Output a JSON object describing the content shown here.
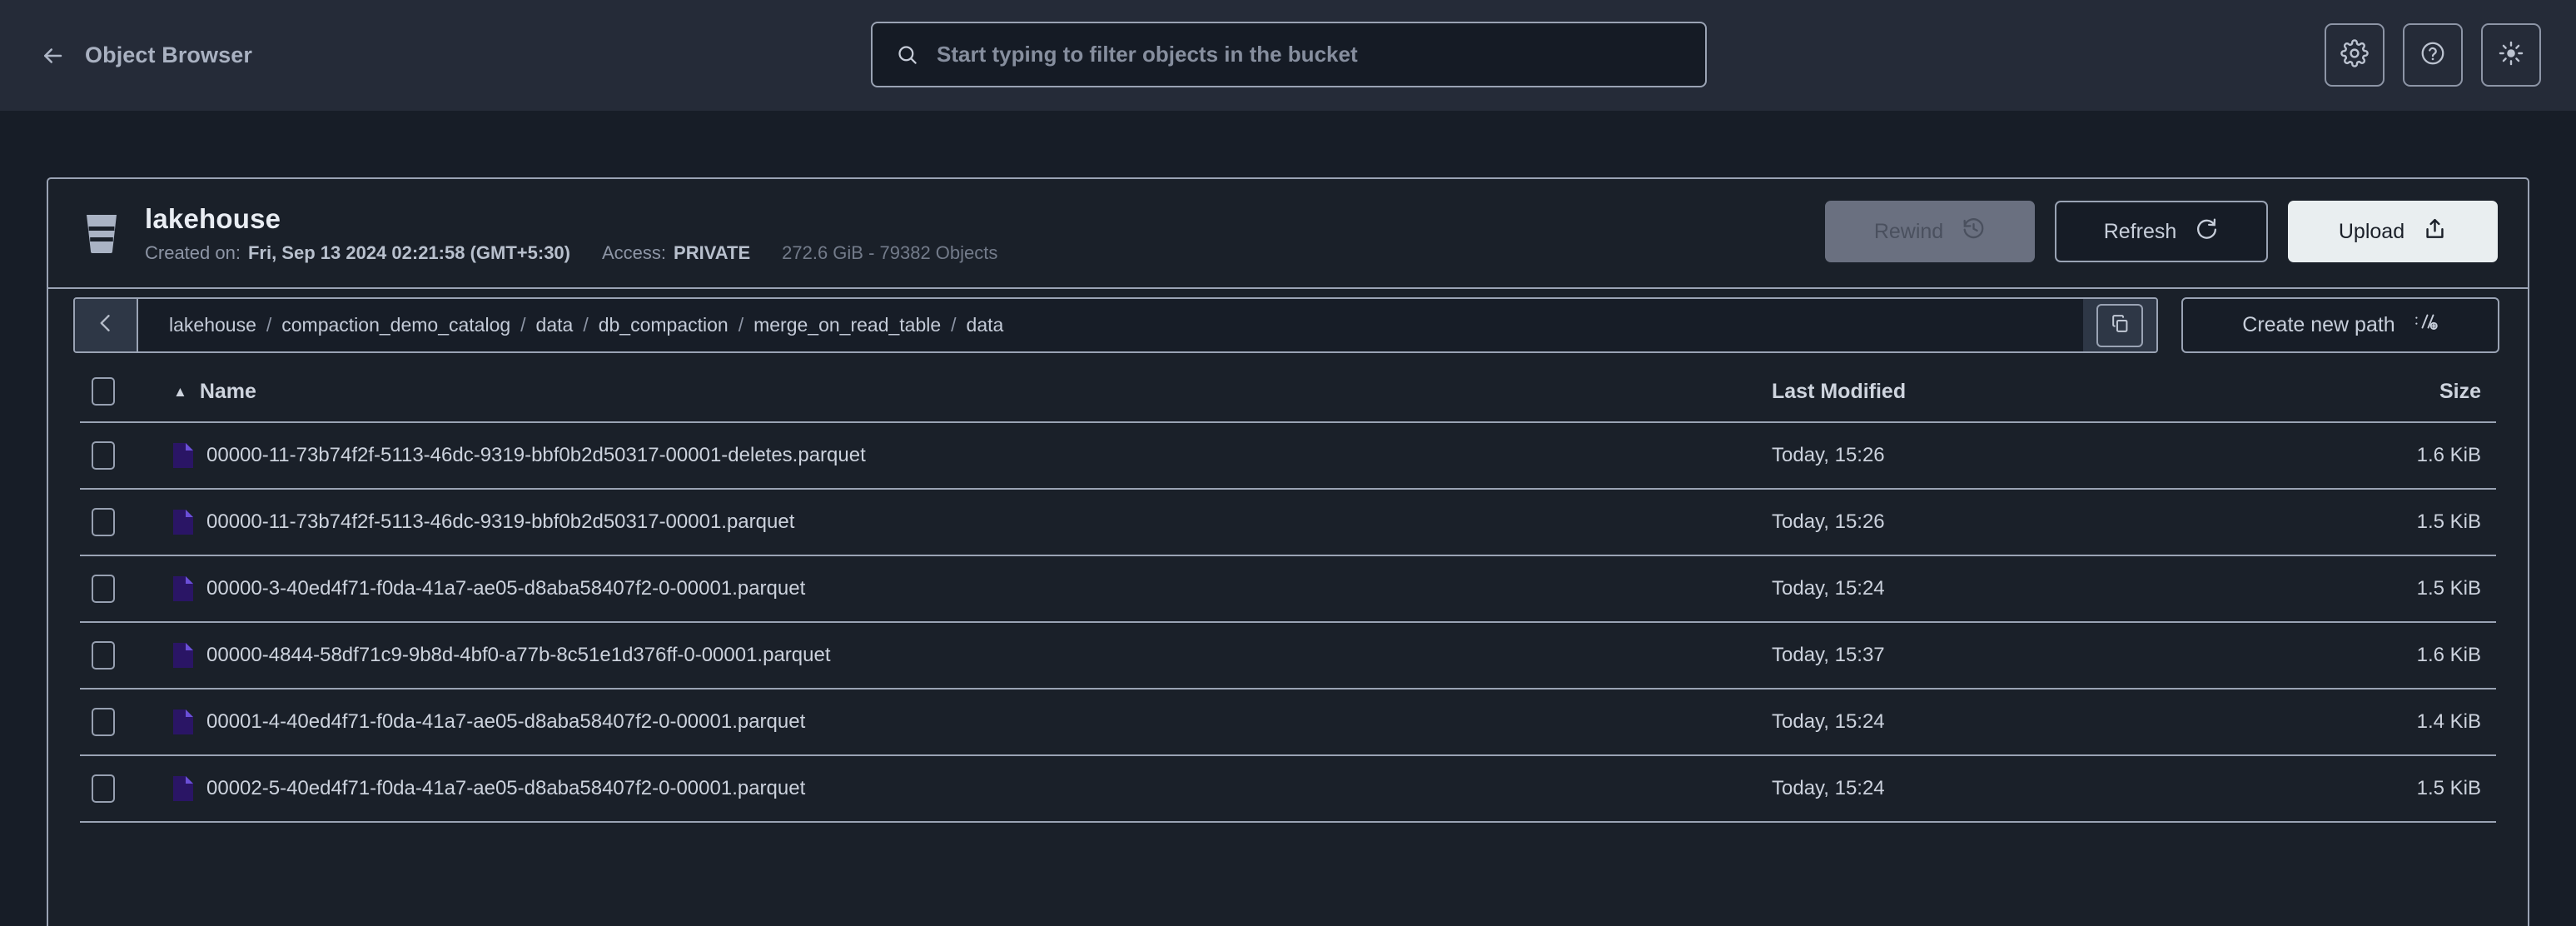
{
  "topbar": {
    "back_label": "Object Browser",
    "back_icon": "arrow-left-icon",
    "search": {
      "placeholder": "Start typing to filter objects in the bucket",
      "value": "",
      "icon": "search-icon"
    },
    "actions": [
      {
        "name": "settings",
        "icon": "gear-icon"
      },
      {
        "name": "help",
        "icon": "question-circle-icon"
      },
      {
        "name": "theme-toggle",
        "icon": "sun-icon"
      }
    ]
  },
  "bucket": {
    "icon": "bucket-icon",
    "name": "lakehouse",
    "created_label": "Created on:",
    "created_value": "Fri, Sep 13 2024 02:21:58 (GMT+5:30)",
    "access_label": "Access:",
    "access_value": "PRIVATE",
    "usage": "272.6 GiB - 79382 Objects",
    "actions": {
      "rewind": {
        "label": "Rewind",
        "icon": "rewind-clock-icon",
        "disabled": true
      },
      "refresh": {
        "label": "Refresh",
        "icon": "refresh-icon"
      },
      "upload": {
        "label": "Upload",
        "icon": "upload-icon"
      }
    }
  },
  "breadcrumb": {
    "back_icon": "chevron-left-icon",
    "segments": [
      "lakehouse",
      "compaction_demo_catalog",
      "data",
      "db_compaction",
      "merge_on_read_table",
      "data"
    ],
    "separator": "/",
    "copy_icon": "copy-icon",
    "create_path_label": "Create new path",
    "create_path_icon": "path-plus-icon"
  },
  "table": {
    "columns": {
      "name": "Name",
      "last_modified": "Last Modified",
      "size": "Size"
    },
    "sort": {
      "column": "Name",
      "direction": "asc",
      "caret": "▲"
    },
    "rows": [
      {
        "name": "00000-11-73b74f2f-5113-46dc-9319-bbf0b2d50317-00001-deletes.parquet",
        "modified": "Today, 15:26",
        "size": "1.6 KiB",
        "icon": "parquet-file-icon"
      },
      {
        "name": "00000-11-73b74f2f-5113-46dc-9319-bbf0b2d50317-00001.parquet",
        "modified": "Today, 15:26",
        "size": "1.5 KiB",
        "icon": "parquet-file-icon"
      },
      {
        "name": "00000-3-40ed4f71-f0da-41a7-ae05-d8aba58407f2-0-00001.parquet",
        "modified": "Today, 15:24",
        "size": "1.5 KiB",
        "icon": "parquet-file-icon"
      },
      {
        "name": "00000-4844-58df71c9-9b8d-4bf0-a77b-8c51e1d376ff-0-00001.parquet",
        "modified": "Today, 15:37",
        "size": "1.6 KiB",
        "icon": "parquet-file-icon"
      },
      {
        "name": "00001-4-40ed4f71-f0da-41a7-ae05-d8aba58407f2-0-00001.parquet",
        "modified": "Today, 15:24",
        "size": "1.4 KiB",
        "icon": "parquet-file-icon"
      },
      {
        "name": "00002-5-40ed4f71-f0da-41a7-ae05-d8aba58407f2-0-00001.parquet",
        "modified": "Today, 15:24",
        "size": "1.5 KiB",
        "icon": "parquet-file-icon"
      }
    ]
  },
  "colors": {
    "page_bg": "#171d27",
    "topbar_bg": "#252b38",
    "panel_bg": "#1a2029",
    "border": "#9aa3b4",
    "text_primary": "#ced4de",
    "text_muted": "#8d95a5",
    "file_icon": "#2a1565",
    "upload_btn": "#e9eef0",
    "rewind_disabled": "#6a7080"
  }
}
